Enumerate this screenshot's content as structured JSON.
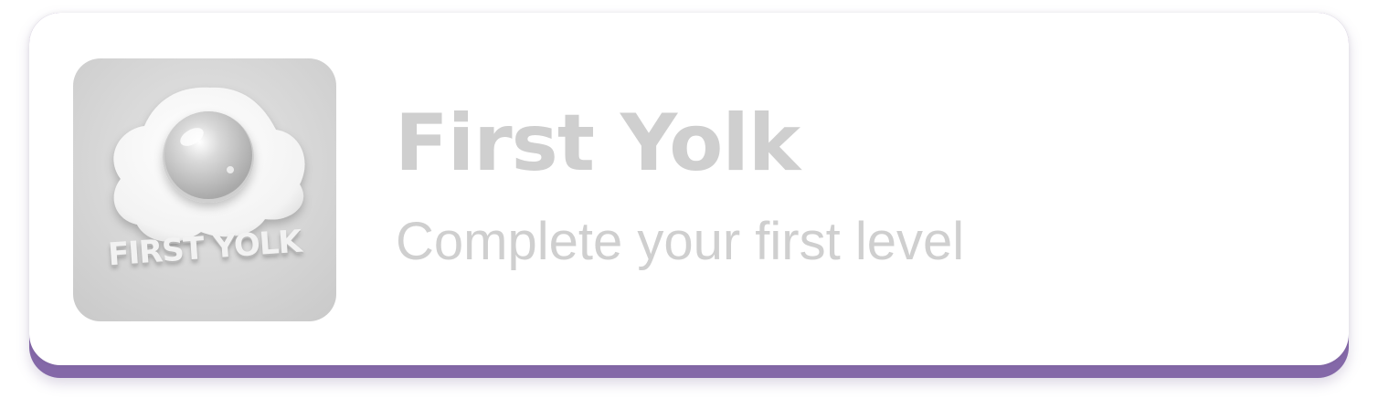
{
  "achievement": {
    "title": "First Yolk",
    "description": "Complete your first level",
    "badge_caption": "FIRST YOLK",
    "badge_icon": "fried-egg-icon",
    "locked": true
  },
  "colors": {
    "card_background": "#ffffff",
    "card_bottom_edge": "#8468a8",
    "muted_text": "#cfcfcf",
    "badge_tile": "#d6d6d6"
  }
}
